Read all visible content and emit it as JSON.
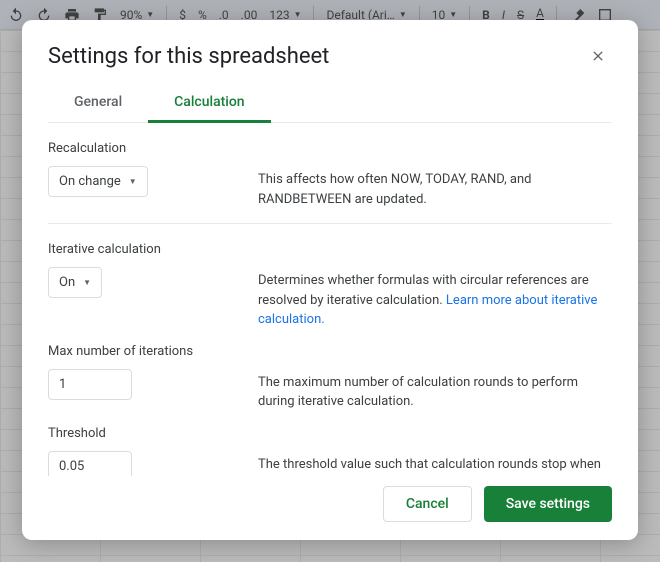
{
  "toolbar": {
    "zoom": "90%",
    "currency": "$",
    "percent": "%",
    "dec_dec": ".0",
    "dec_inc": ".00",
    "format_more": "123",
    "font": "Default (Ari…",
    "font_size": "10",
    "bold": "B",
    "italic": "I",
    "strike": "S",
    "text_color": "A"
  },
  "dialog": {
    "title": "Settings for this spreadsheet",
    "tabs": {
      "general": "General",
      "calculation": "Calculation"
    },
    "recalc": {
      "label": "Recalculation",
      "value": "On change",
      "desc": "This affects how often NOW, TODAY, RAND, and RANDBETWEEN are updated."
    },
    "iter": {
      "label": "Iterative calculation",
      "value": "On",
      "desc_pre": "Determines whether formulas with circular references are resolved by iterative calculation. ",
      "desc_link": "Learn more about iterative calculation."
    },
    "max_iter": {
      "label": "Max number of iterations",
      "value": "1",
      "desc": "The maximum number of calculation rounds to perform during iterative calculation."
    },
    "threshold": {
      "label": "Threshold",
      "value": "0.05",
      "desc": "The threshold value such that calculation rounds stop when successive results differ by less."
    },
    "footer": {
      "cancel": "Cancel",
      "save": "Save settings"
    }
  }
}
